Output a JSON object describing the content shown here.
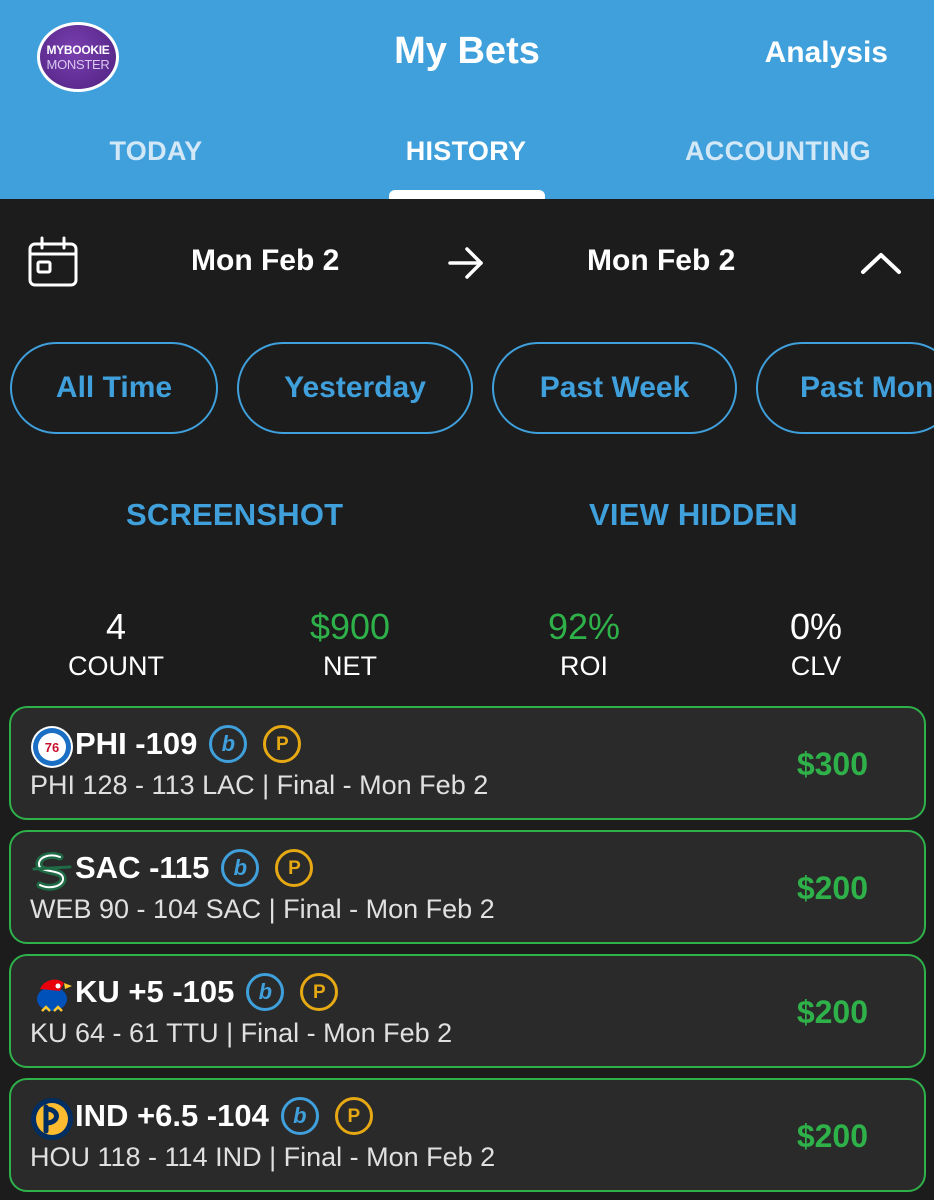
{
  "header": {
    "logo_line1": "MYBOOKIE",
    "logo_line2": "MONSTER",
    "title": "My Bets",
    "analysis": "Analysis",
    "tabs": [
      {
        "label": "TODAY"
      },
      {
        "label": "HISTORY",
        "active": true
      },
      {
        "label": "ACCOUNTING"
      }
    ]
  },
  "date_range": {
    "start": "Mon Feb 2",
    "end": "Mon Feb 2"
  },
  "filters": [
    {
      "label": "All Time"
    },
    {
      "label": "Yesterday"
    },
    {
      "label": "Past Week"
    },
    {
      "label": "Past Mon"
    }
  ],
  "actions": {
    "screenshot": "SCREENSHOT",
    "view_hidden": "VIEW HIDDEN"
  },
  "stats": [
    {
      "value": "4",
      "label": "COUNT"
    },
    {
      "value": "$900",
      "label": "NET"
    },
    {
      "value": "92%",
      "label": "ROI"
    },
    {
      "value": "0%",
      "label": "CLV"
    }
  ],
  "bets": [
    {
      "pick": "PHI -109",
      "detail": "PHI 128 - 113 LAC | Final  - Mon Feb 2",
      "amount": "$300",
      "logo": "sixers-icon"
    },
    {
      "pick": "SAC -115",
      "detail": "WEB 90 - 104 SAC | Final  - Mon Feb 2",
      "amount": "$200",
      "logo": "sacramento-state-icon"
    },
    {
      "pick": "KU +5 -105",
      "detail": "KU 64 - 61 TTU | Final  - Mon Feb 2",
      "amount": "$200",
      "logo": "jayhawk-icon"
    },
    {
      "pick": "IND +6.5 -104",
      "detail": "HOU 118 - 114 IND | Final  - Mon Feb 2",
      "amount": "$200",
      "logo": "pacers-icon"
    }
  ],
  "badges": {
    "b": "b",
    "p": "P"
  },
  "colors": {
    "header_blue": "#3fa0dc",
    "background": "#1c1c1c",
    "card": "#2a2a2a",
    "win_green": "#2fb14a",
    "badge_gold": "#e6a914"
  }
}
